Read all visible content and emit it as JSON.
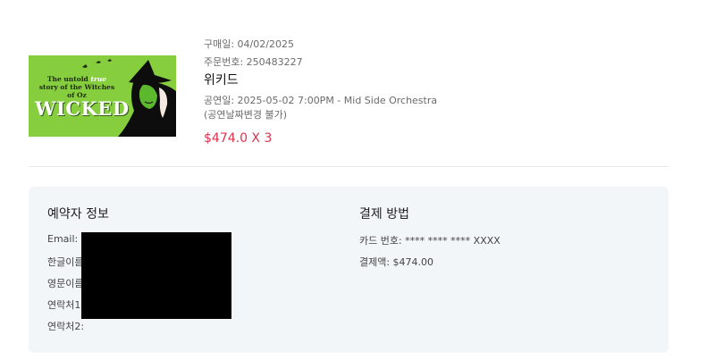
{
  "order": {
    "poster": {
      "tagline_pre": "The untold",
      "tagline_true": "true",
      "tagline_post": "story of the Witches of Oz",
      "title": "WICKED"
    },
    "purchase_date": "구매일: 04/02/2025",
    "order_number": "주문번호: 250483227",
    "show_title": "위키드",
    "performance": "공연일: 2025-05-02 7:00PM - Mid Side Orchestra",
    "note": "(공연날짜변경 불가)",
    "price": "$474.0 X 3"
  },
  "booker": {
    "heading": "예약자 정보",
    "labels": [
      "Email:",
      "한글이름",
      "영문이름",
      "연락처1",
      "연락처2:"
    ]
  },
  "payment": {
    "heading": "결제 방법",
    "card": "카드 번호: **** **** **** XXXX",
    "amount": "결제액: $474.00"
  },
  "colors": {
    "price": "#e0334f",
    "panel_bg": "#f3f6f9",
    "poster_green": "#7ec83a"
  }
}
